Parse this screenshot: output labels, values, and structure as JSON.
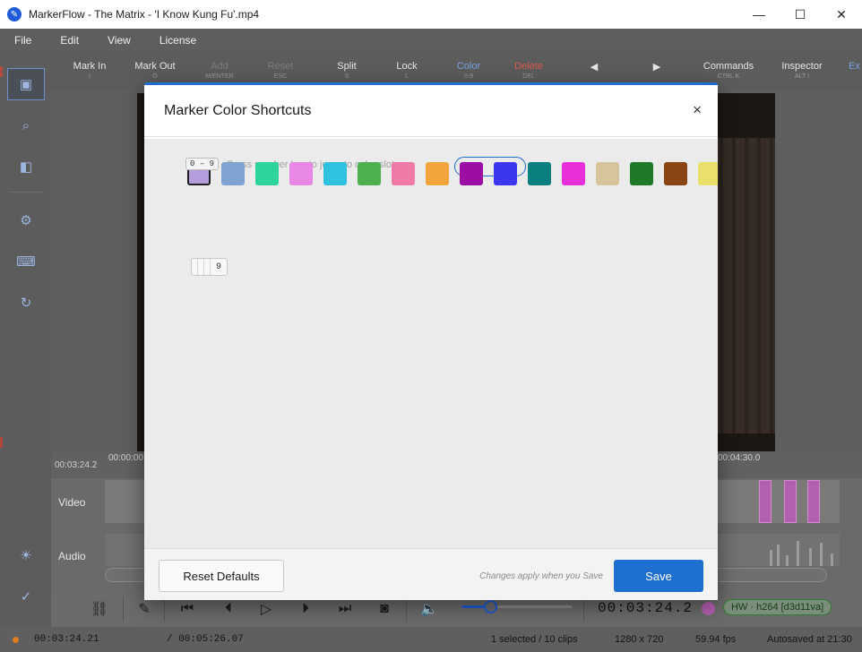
{
  "window": {
    "title": "MarkerFlow - The Matrix - 'I Know Kung Fu'.mp4",
    "minimize": "—",
    "maximize": "☐",
    "close": "✕"
  },
  "menu": [
    "File",
    "Edit",
    "View",
    "License"
  ],
  "toolbar": {
    "items": [
      {
        "label": "Mark In",
        "shortcut": "I"
      },
      {
        "label": "Mark Out",
        "shortcut": "O"
      },
      {
        "label": "Add",
        "shortcut": "M/ENTER"
      },
      {
        "label": "Reset",
        "shortcut": "ESC"
      },
      {
        "label": "Split",
        "shortcut": "S"
      },
      {
        "label": "Lock",
        "shortcut": "L"
      },
      {
        "label": "Color",
        "shortcut": "0-9"
      },
      {
        "label": "Delete",
        "shortcut": "DEL"
      },
      {
        "label": "◀",
        "shortcut": ""
      },
      {
        "label": "▶",
        "shortcut": ""
      },
      {
        "label": "Commands",
        "shortcut": "CTRL K"
      },
      {
        "label": "Inspector",
        "shortcut": "ALT I"
      },
      {
        "label": "Ex",
        "shortcut": ""
      }
    ]
  },
  "timeline": {
    "current_time": "00:03:24.2",
    "ruler_start": "00:00:00",
    "ruler_end": "00:04:30.0",
    "tracks": [
      "Video",
      "Audio"
    ]
  },
  "dialog": {
    "title": "Marker Color Shortcuts",
    "close": "×",
    "key_range": "0 – 9",
    "hint": "Press number key to jump to color slots",
    "key_label": "9",
    "swatches": [
      "#b39ddb",
      "#7fa3d1",
      "#2ed39a",
      "#e987e5",
      "#2ec2e0",
      "#4caf50",
      "#f07aa7",
      "#f0a63d",
      "#9c0ea3",
      "#3b36f0",
      "#0a8080",
      "#e830d8",
      "#d6c59a",
      "#1e7a27",
      "#8b4513",
      "#e8e06a"
    ],
    "reset_label": "Reset Defaults",
    "footer_note": "Changes apply when you Save",
    "save_label": "Save"
  },
  "transport": {
    "timecode": "00:03:24.2",
    "volume": 0.26,
    "badge": "HW · h264 [d3d11va]"
  },
  "status": {
    "current": "00:03:24.21",
    "total": "/ 00:05:26.07",
    "selection": "1 selected / 10 clips",
    "resolution": "1280 x 720",
    "fps": "59.94 fps",
    "autosave": "Autosaved at 21:30"
  },
  "colors": {
    "accent": "#1f6fd0",
    "clip_marker": "#b35fb0",
    "hw_badge": "#2f7d2f"
  }
}
